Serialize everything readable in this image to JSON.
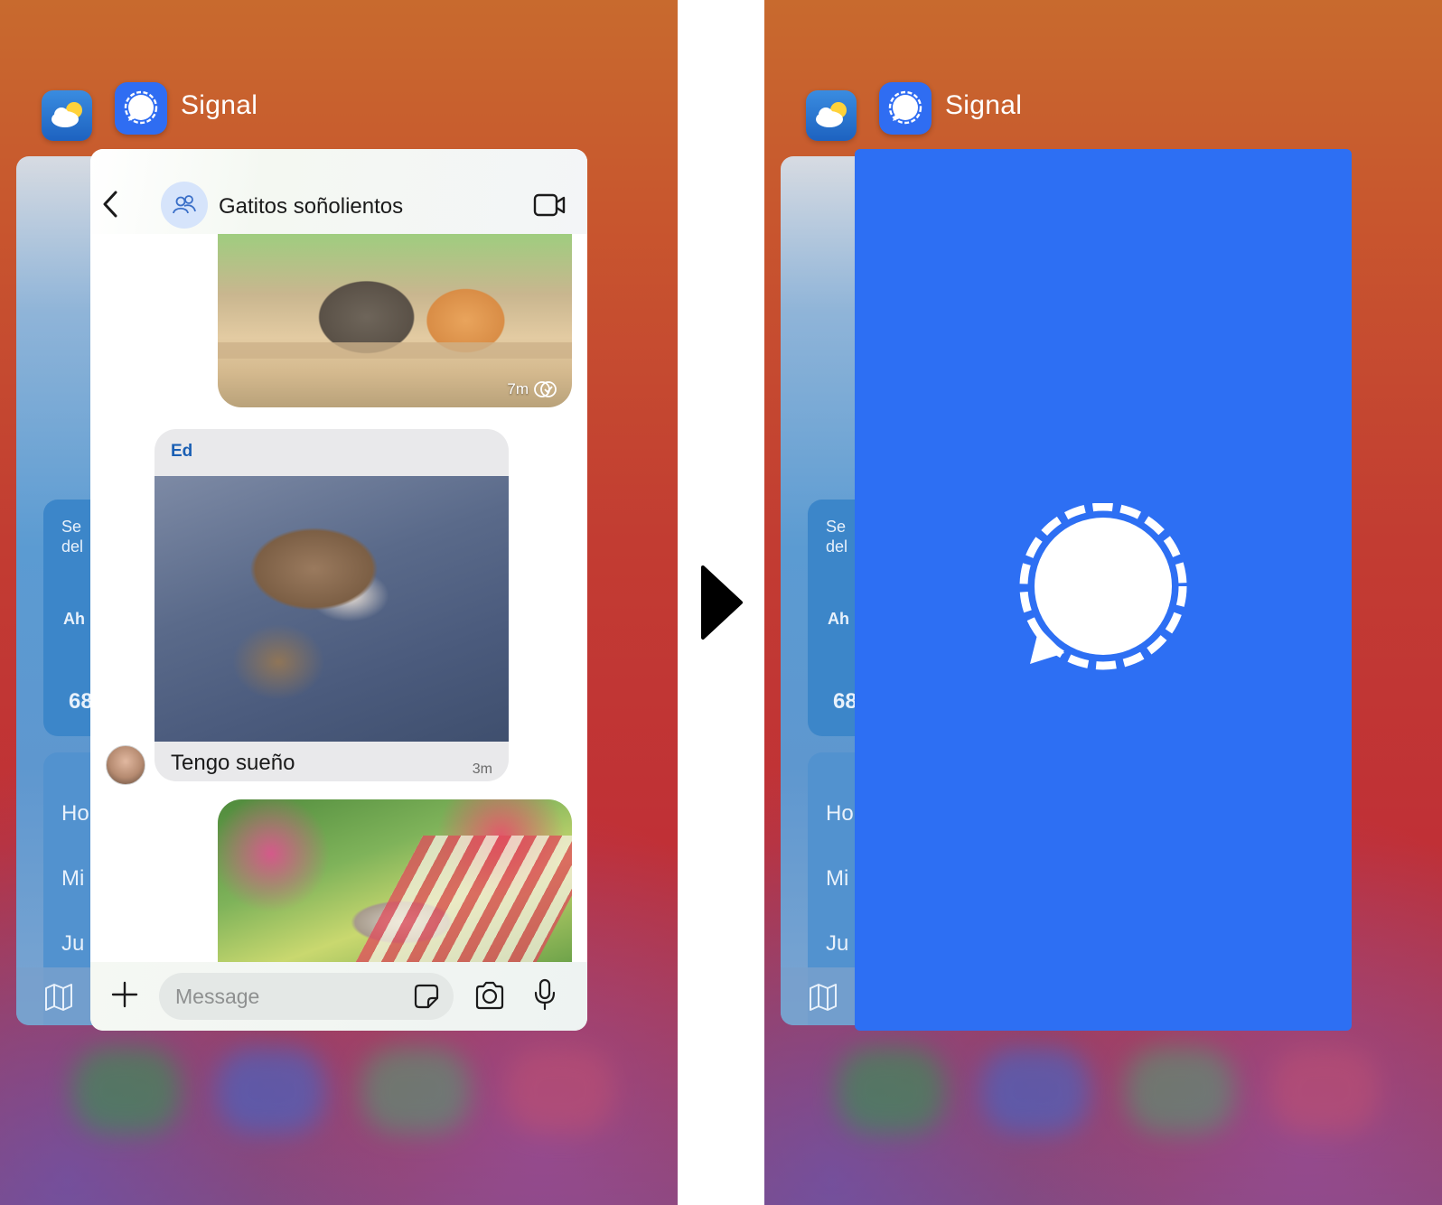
{
  "switcher": {
    "app_name": "Signal",
    "weather_icon": "weather-cloud-sun-icon",
    "signal_icon": "signal-chat-bubble-icon"
  },
  "background_card": {
    "fragments": [
      "Se",
      "del",
      "Ah",
      "68",
      "Ho",
      "Mi",
      "Ju"
    ]
  },
  "chat": {
    "title": "Gatitos soñolientos",
    "messages": [
      {
        "type": "photo",
        "time": "7m"
      },
      {
        "type": "photo_caption",
        "sender": "Ed",
        "text": "Tengo sueño",
        "time": "3m"
      },
      {
        "type": "photo"
      }
    ],
    "composer": {
      "placeholder": "Message"
    }
  },
  "colors": {
    "signal_blue": "#2d6ff3",
    "sender_name": "#1a5fb4",
    "bubble_gray": "#e9e9eb"
  }
}
